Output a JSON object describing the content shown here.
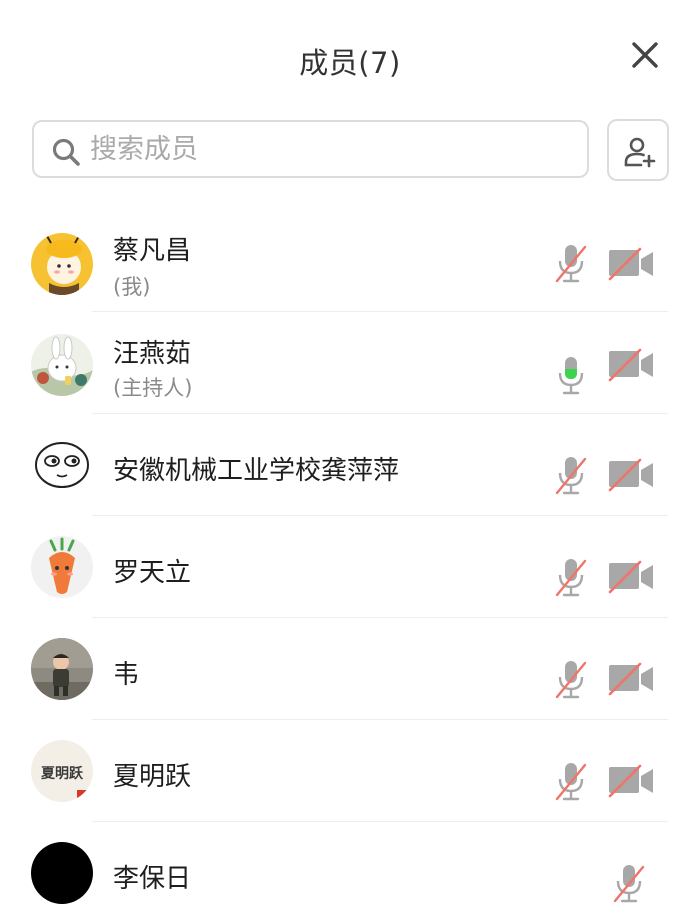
{
  "header": {
    "title": "成员(7)"
  },
  "search": {
    "placeholder": "搜索成员"
  },
  "members": [
    {
      "name": "蔡凡昌",
      "sub": "(我)",
      "mic": "muted",
      "camera": "off"
    },
    {
      "name": "汪燕茹",
      "sub": "(主持人)",
      "mic": "active",
      "camera": "off"
    },
    {
      "name": "安徽机械工业学校龚萍萍",
      "sub": "",
      "mic": "muted",
      "camera": "off"
    },
    {
      "name": "罗天立",
      "sub": "",
      "mic": "muted",
      "camera": "off"
    },
    {
      "name": "韦",
      "sub": "",
      "mic": "muted",
      "camera": "off"
    },
    {
      "name": "夏明跃",
      "sub": "",
      "mic": "muted",
      "camera": "off",
      "avatar_text": "夏明跃"
    },
    {
      "name": "李保日",
      "sub": "",
      "mic": "muted"
    }
  ],
  "icons": {
    "close": "close-icon",
    "search": "search-icon",
    "add_member": "add-user-icon",
    "mic_muted": "mic-muted-icon",
    "mic_active": "mic-active-icon",
    "camera_off": "camera-off-icon"
  },
  "colors": {
    "mute_slash": "#f0746a",
    "mic_active": "#3ed34f",
    "icon_gray": "#a8a8a8",
    "divider": "#eeeeee"
  }
}
